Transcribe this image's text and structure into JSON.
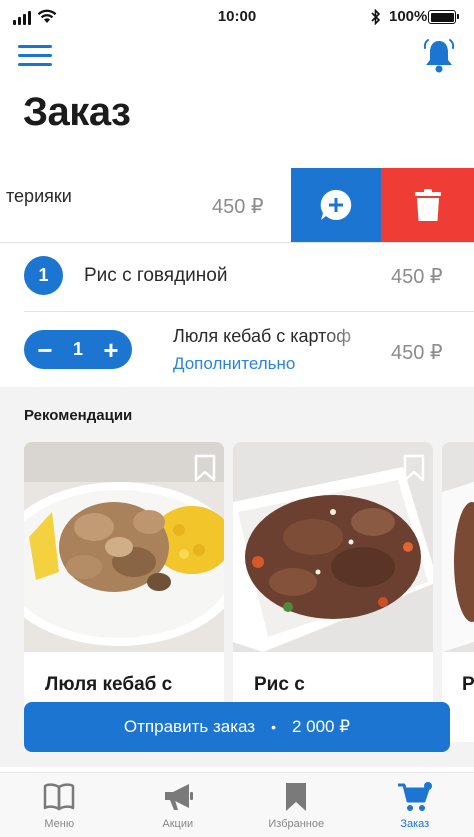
{
  "status_bar": {
    "time": "10:00",
    "battery": "100%"
  },
  "header": {
    "title": "Заказ"
  },
  "order": {
    "swiped_item": {
      "name": "терияки",
      "price": "450 ₽"
    },
    "items": [
      {
        "quantity": "1",
        "name": "Рис с говядиной",
        "price": "450 ₽"
      },
      {
        "quantity": "1",
        "name": "Люля кебаб с картоф",
        "extra": "Дополнительно",
        "price": "450 ₽"
      }
    ]
  },
  "recommendations": {
    "title": "Рекомендации",
    "cards": [
      {
        "name": "Люля кебаб с"
      },
      {
        "name": "Рис с"
      },
      {
        "name": "Р"
      }
    ]
  },
  "submit": {
    "label": "Отправить заказ",
    "separator": "•",
    "total": "2 000 ₽"
  },
  "tabs": [
    {
      "label": "Меню",
      "icon": "book-icon"
    },
    {
      "label": "Акции",
      "icon": "megaphone-icon"
    },
    {
      "label": "Избранное",
      "icon": "bookmark-icon"
    },
    {
      "label": "Заказ",
      "icon": "cart-icon",
      "active": true
    }
  ],
  "colors": {
    "accent": "#1c75d1",
    "delete": "#ef3d35",
    "link": "#2c85d6"
  }
}
